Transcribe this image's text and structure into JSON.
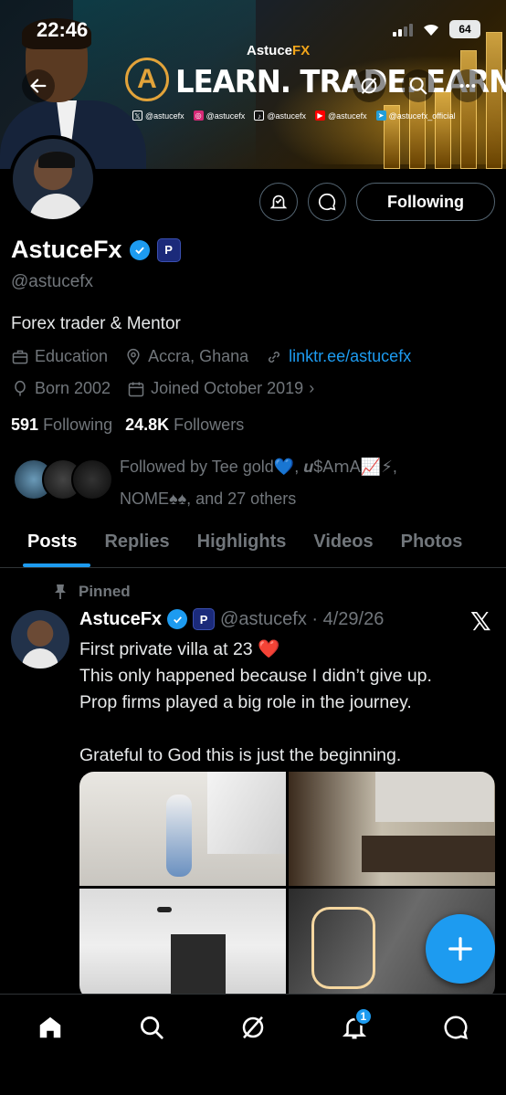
{
  "status_bar": {
    "time": "22:46",
    "battery": "64"
  },
  "banner": {
    "brand_prefix": "Astuce",
    "brand_suffix": "FX",
    "title": "LEARN. TRADE. EARN.",
    "socials": [
      "@astucefx",
      "@astucefx",
      "@astucefx",
      "@astucefx",
      "@astucefx_official"
    ]
  },
  "profile": {
    "follow_button": "Following",
    "name": "AstuceFx",
    "badge_label": "P",
    "handle": "@astucefx",
    "bio": "Forex trader & Mentor",
    "category": "Education",
    "location": "Accra, Ghana",
    "link": "linktr.ee/astucefx",
    "born": "Born 2002",
    "joined": "Joined October 2019",
    "following_count": "591",
    "following_label": "Following",
    "followers_count": "24.8K",
    "followers_label": "Followers",
    "followed_by": "Followed by Tee gold💙, 𝒖$A𝗆A📈⚡,",
    "followed_by_2": "NOME♠♠, and 27 others"
  },
  "tabs": [
    "Posts",
    "Replies",
    "Highlights",
    "Videos",
    "Photos"
  ],
  "post": {
    "pinned_label": "Pinned",
    "name": "AstuceFx",
    "handle_date": "@astucefx · 4/29/26",
    "text": "First private villa at 23 ❤️\nThis only happened because I didn’t give up.\nProp firms played a big role in the journey.\n\nGrateful to God this is just the beginning."
  },
  "bottom_nav": {
    "notification_count": "1"
  },
  "colors": {
    "accent": "#1d9bf0",
    "background": "#000000",
    "muted": "#71767b",
    "brand_gold": "#e2a33a"
  }
}
